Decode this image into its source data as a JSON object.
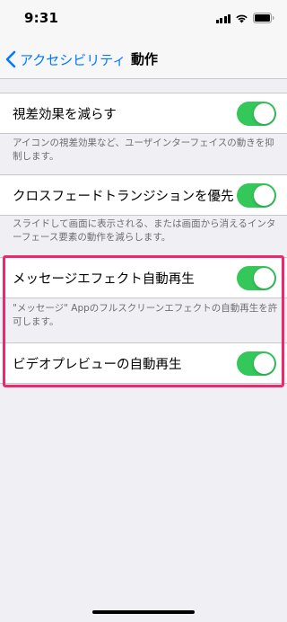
{
  "status_bar": {
    "time": "9:31",
    "icons": [
      "signal-icon",
      "wifi-icon",
      "battery-icon"
    ]
  },
  "nav": {
    "back_label": "アクセシビリティ",
    "back_icon": "chevron-left-icon",
    "title": "動作"
  },
  "settings": [
    {
      "label": "視差効果を減らす",
      "enabled": true,
      "footnote": "アイコンの視差効果など、ユーザインターフェイスの動きを抑制します。"
    },
    {
      "label": "クロスフェードトランジションを優先",
      "enabled": true,
      "footnote": "スライドして画面に表示される、または画面から消えるインターフェース要素の動作を減らします。"
    },
    {
      "label": "メッセージエフェクト自動再生",
      "enabled": true,
      "footnote": "\"メッセージ\" Appのフルスクリーンエフェクトの自動再生を許可します。"
    },
    {
      "label": "ビデオプレビューの自動再生",
      "enabled": true
    }
  ],
  "colors": {
    "accent": "#007aff",
    "toggle_on": "#34c759",
    "highlight": "#ea2a70",
    "background": "#efeff4",
    "footnote": "#6d6d72"
  }
}
